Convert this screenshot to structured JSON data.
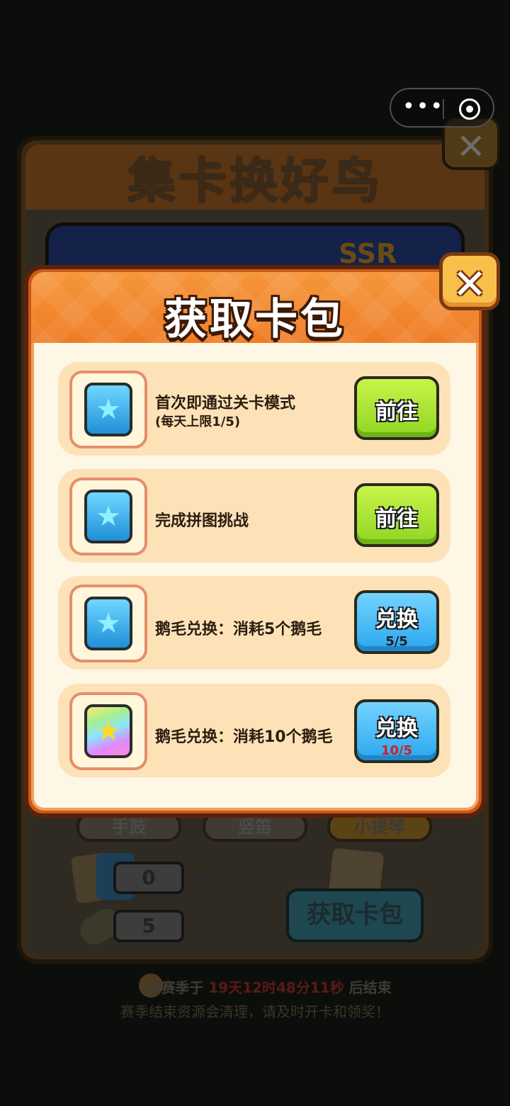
{
  "background": {
    "title": "集卡换好鸟",
    "ssr_label": "SSR",
    "close_glyph": "✕",
    "tabs": [
      {
        "label": "手鼓"
      },
      {
        "label": "竖笛"
      },
      {
        "label": "小提琴"
      }
    ],
    "pack_count": "0",
    "feather_count": "5",
    "plus_glyph": "+",
    "get_pack_button": "获取卡包",
    "season": {
      "prefix": "本赛季于",
      "countdown": "19天12时48分11秒",
      "suffix": "后结束",
      "notice": "赛季结束资源会清理，请及时开卡和领奖！"
    }
  },
  "capsule": {
    "more_glyph": "•••"
  },
  "modal": {
    "title": "获取卡包",
    "close_glyph": "✕",
    "tasks": [
      {
        "pack": "blue",
        "label": "首次即通过关卡模式",
        "sub": "(每天上限1/5)",
        "button": "前往",
        "progress": ""
      },
      {
        "pack": "blue",
        "label": "完成拼图挑战",
        "sub": "",
        "button": "前往",
        "progress": ""
      },
      {
        "pack": "blue",
        "label": "鹅毛兑换：消耗5个鹅毛",
        "sub": "",
        "button": "兑换",
        "progress": "5/5"
      },
      {
        "pack": "rainbow",
        "label": "鹅毛兑换：消耗10个鹅毛",
        "sub": "",
        "button": "兑换",
        "progress": "10/5"
      }
    ],
    "star_glyph": "★"
  },
  "colors": {
    "modal_header": "#ee7a23",
    "go_button": "#8fd623",
    "exchange_button": "#2aa7ee",
    "over_limit": "#d12020"
  }
}
